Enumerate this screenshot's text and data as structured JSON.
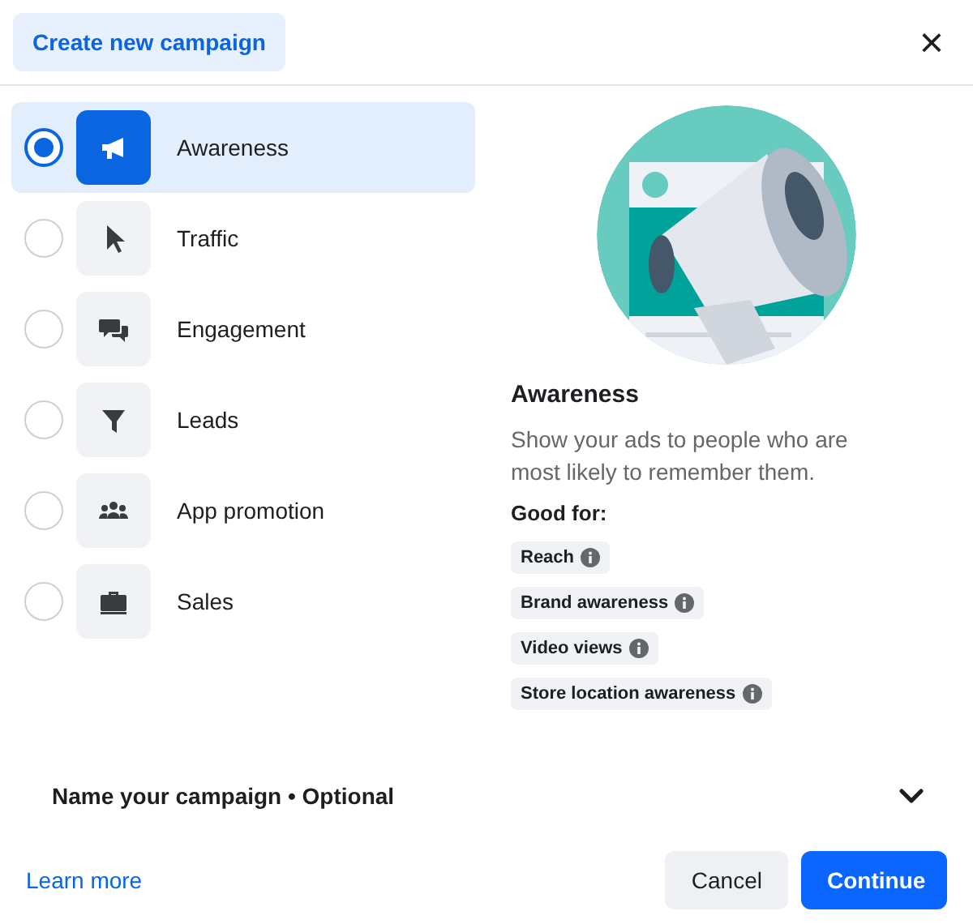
{
  "header": {
    "tab": "Create new campaign",
    "close": "×"
  },
  "objectives": [
    {
      "label": "Awareness",
      "selected": true
    },
    {
      "label": "Traffic",
      "selected": false
    },
    {
      "label": "Engagement",
      "selected": false
    },
    {
      "label": "Leads",
      "selected": false
    },
    {
      "label": "App promotion",
      "selected": false
    },
    {
      "label": "Sales",
      "selected": false
    }
  ],
  "detail": {
    "title": "Awareness",
    "description": "Show your ads to people who are most likely to remember them.",
    "good_for_label": "Good for:",
    "tags": [
      "Reach",
      "Brand awareness",
      "Video views",
      "Store location awareness"
    ]
  },
  "name_section": {
    "label": "Name your campaign • Optional",
    "expanded": false
  },
  "footer": {
    "link": "Learn more",
    "buttons": [
      {
        "label": "Cancel",
        "kind": "secondary"
      },
      {
        "label": "Continue",
        "kind": "primary"
      }
    ]
  }
}
